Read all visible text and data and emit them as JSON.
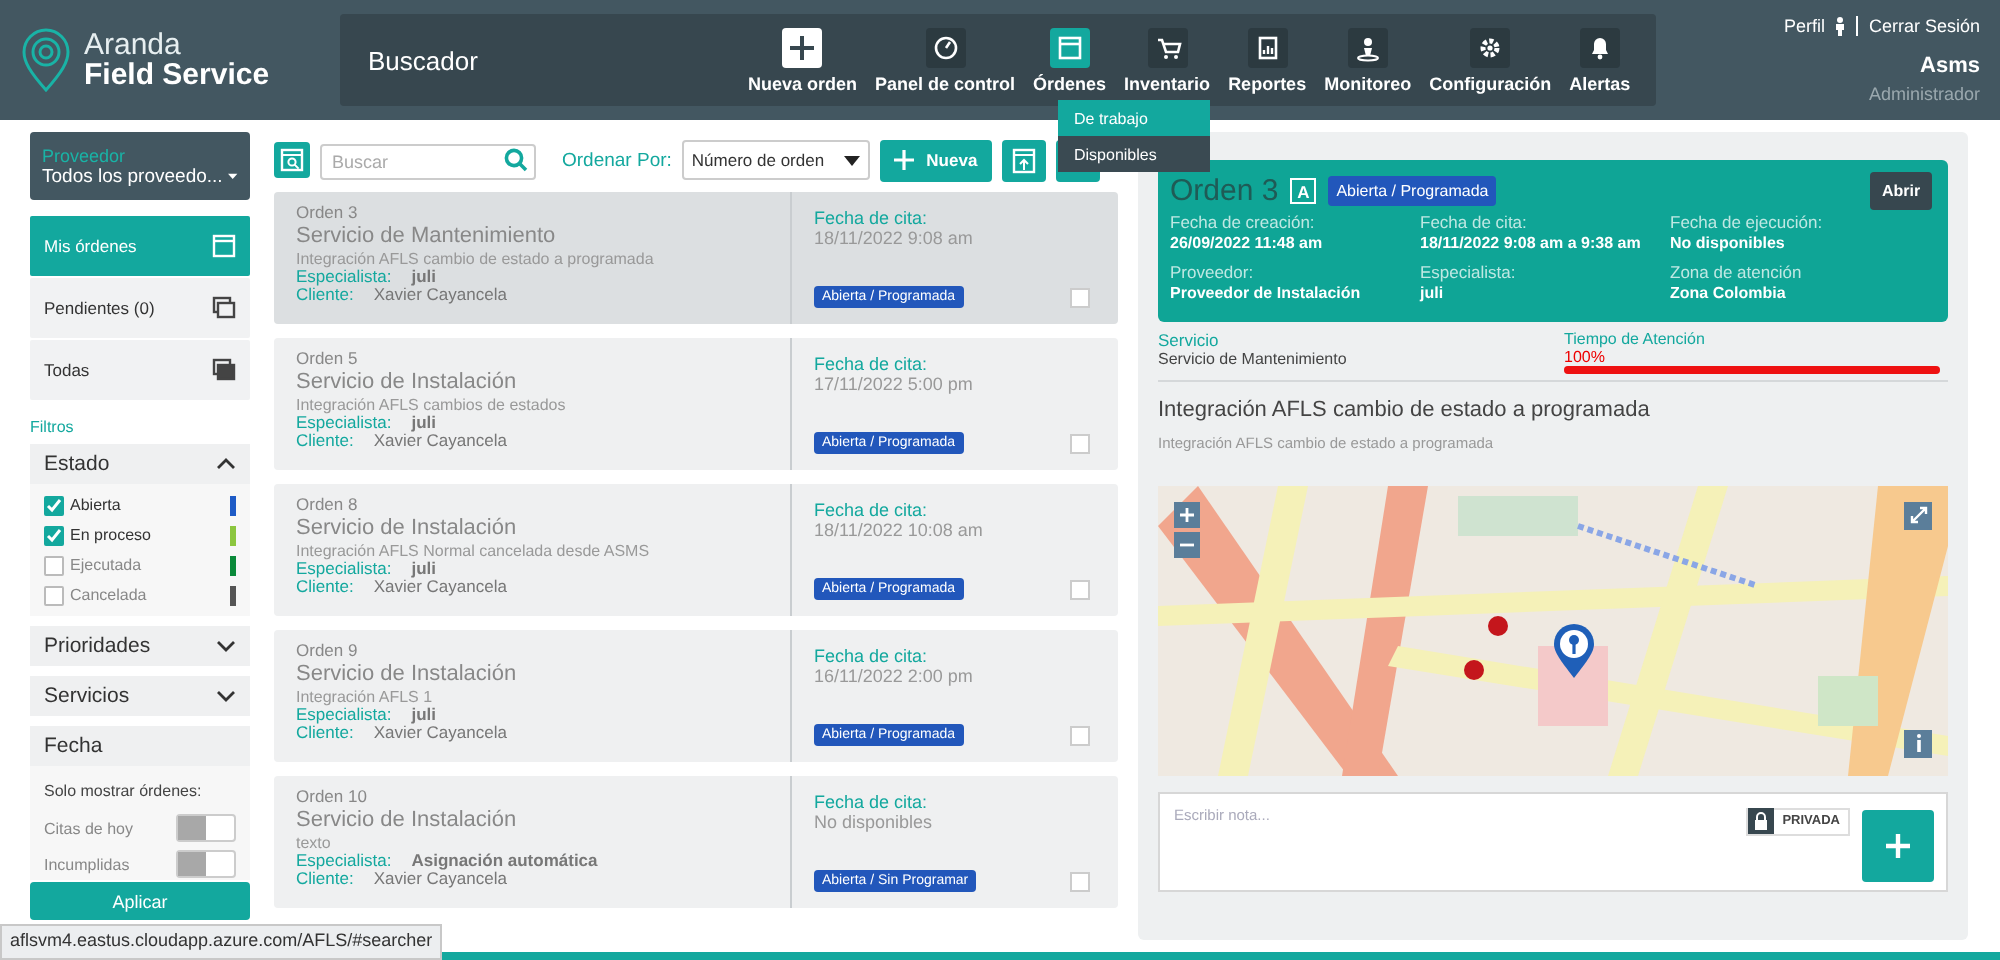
{
  "header": {
    "brand_top": "Aranda",
    "brand_bottom": "Field Service",
    "section_title": "Buscador",
    "nav": [
      {
        "label": "Nueva orden",
        "selected": false
      },
      {
        "label": "Panel de control",
        "selected": false
      },
      {
        "label": "Órdenes",
        "selected": true
      },
      {
        "label": "Inventario",
        "selected": false
      },
      {
        "label": "Reportes",
        "selected": false
      },
      {
        "label": "Monitoreo",
        "selected": false
      },
      {
        "label": "Configuración",
        "selected": false
      },
      {
        "label": "Alertas",
        "selected": false
      }
    ],
    "profile_link": "Perfil",
    "logout_link": "Cerrar Sesión",
    "user_name": "Asms",
    "user_role": "Administrador"
  },
  "orders_submenu": [
    {
      "label": "De trabajo",
      "selected": true
    },
    {
      "label": "Disponibles",
      "selected": false
    }
  ],
  "sidebar": {
    "provider_label": "Proveedor",
    "provider_value": "Todos los proveedo...",
    "views": [
      {
        "label": "Mis órdenes",
        "selected": true
      },
      {
        "label": "Pendientes (0)",
        "selected": false
      },
      {
        "label": "Todas",
        "selected": false
      }
    ],
    "filters_title": "Filtros",
    "status_filter": {
      "title": "Estado",
      "expanded": true,
      "options": [
        {
          "label": "Abierta",
          "checked": true,
          "color": "#1e5bc6"
        },
        {
          "label": "En proceso",
          "checked": true,
          "color": "#8cc63f"
        },
        {
          "label": "Ejecutada",
          "checked": false,
          "color": "#0a8a3a"
        },
        {
          "label": "Cancelada",
          "checked": false,
          "color": "#555555"
        }
      ]
    },
    "collapsed_filters": [
      {
        "title": "Prioridades",
        "expanded": false
      },
      {
        "title": "Servicios",
        "expanded": false
      }
    ],
    "date_filter": {
      "title": "Fecha",
      "subtitle": "Solo mostrar órdenes:",
      "toggles": [
        {
          "label": "Citas de hoy",
          "on": false
        },
        {
          "label": "Incumplidas",
          "on": false
        }
      ]
    },
    "apply_button": "Aplicar"
  },
  "list_toolbar": {
    "search_placeholder": "Buscar",
    "sort_label": "Ordenar Por:",
    "sort_value": "Número de orden",
    "new_button": "Nueva"
  },
  "orders": [
    {
      "number": "Orden 3",
      "service": "Servicio de Mantenimiento",
      "description": "Integración AFLS cambio de estado a programada",
      "specialist_label": "Especialista:",
      "specialist": "juli",
      "client_label": "Cliente:",
      "client": "Xavier Cayancela",
      "date_label": "Fecha de cita:",
      "date": "18/11/2022 9:08 am",
      "status": "Abierta / Programada",
      "selected": true,
      "checked": false
    },
    {
      "number": "Orden 5",
      "service": "Servicio de Instalación",
      "description": "Integración AFLS cambios de estados",
      "specialist_label": "Especialista:",
      "specialist": "juli",
      "client_label": "Cliente:",
      "client": "Xavier Cayancela",
      "date_label": "Fecha de cita:",
      "date": "17/11/2022 5:00 pm",
      "status": "Abierta / Programada",
      "selected": false,
      "checked": false
    },
    {
      "number": "Orden 8",
      "service": "Servicio de Instalación",
      "description": "Integración AFLS Normal cancelada desde ASMS",
      "specialist_label": "Especialista:",
      "specialist": "juli",
      "client_label": "Cliente:",
      "client": "Xavier Cayancela",
      "date_label": "Fecha de cita:",
      "date": "18/11/2022 10:08 am",
      "status": "Abierta / Programada",
      "selected": false,
      "checked": false
    },
    {
      "number": "Orden 9",
      "service": "Servicio de Instalación",
      "description": "Integración AFLS 1",
      "specialist_label": "Especialista:",
      "specialist": "juli",
      "client_label": "Cliente:",
      "client": "Xavier Cayancela",
      "date_label": "Fecha de cita:",
      "date": "16/11/2022 2:00 pm",
      "status": "Abierta / Programada",
      "selected": false,
      "checked": false
    },
    {
      "number": "Orden 10",
      "service": "Servicio de Instalación",
      "description": "texto",
      "specialist_label": "Especialista:",
      "specialist": "Asignación automática",
      "client_label": "Cliente:",
      "client": "Xavier Cayancela",
      "date_label": "Fecha de cita:",
      "date": "No disponibles",
      "status": "Abierta / Sin Programar",
      "selected": false,
      "checked": false
    }
  ],
  "detail": {
    "title": "Orden",
    "number": "3",
    "priority": "A",
    "status": "Abierta / Programada",
    "open_button": "Abrir",
    "fields": [
      {
        "label": "Fecha de creación:",
        "value": "26/09/2022 11:48 am"
      },
      {
        "label": "Fecha de cita:",
        "value": "18/11/2022 9:08 am a 9:38 am"
      },
      {
        "label": "Fecha de ejecución:",
        "value": "No disponibles"
      },
      {
        "label": "Proveedor:",
        "value": "Proveedor de Instalación"
      },
      {
        "label": "Especialista:",
        "value": "juli"
      },
      {
        "label": "Zona de atención",
        "value": "Zona Colombia"
      }
    ],
    "service_label": "Servicio",
    "service_value": "Servicio de Mantenimiento",
    "attention_label": "Tiempo de Atención",
    "attention_value": "100%",
    "attention": {
      "level": 1
    },
    "subject": "Integración AFLS cambio de estado a programada",
    "description": "Integración AFLS cambio de estado a programada",
    "note_placeholder": "Escribir nota...",
    "private_label": "PRIVADA"
  },
  "status_url": "aflsvm4.eastus.cloudapp.azure.com/AFLS/#searcher"
}
